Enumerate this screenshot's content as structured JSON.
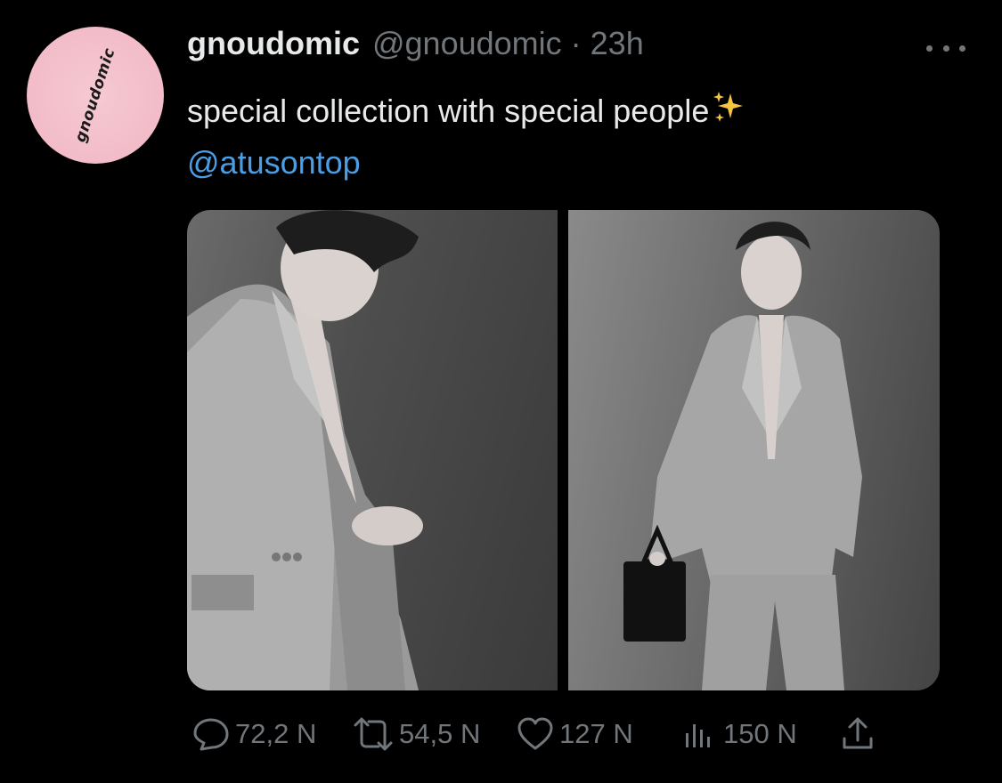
{
  "author": {
    "avatar_text": "gnoudomic",
    "display_name": "gnoudomic",
    "handle": "@gnoudomic",
    "separator": "·",
    "time": "23h"
  },
  "tweet": {
    "text": "special collection with special people",
    "mention": "@atusontop"
  },
  "media": {
    "count": 2,
    "description_alt_1": "",
    "description_alt_2": ""
  },
  "actions": {
    "replies": "72,2 N",
    "retweets": "54,5 N",
    "likes": "127 N",
    "views": "150 N"
  },
  "icons": {
    "more": "more-horizontal-icon",
    "reply": "reply-icon",
    "retweet": "retweet-icon",
    "like": "heart-icon",
    "views": "views-icon",
    "share": "share-icon",
    "sparkle": "sparkles-emoji"
  },
  "colors": {
    "background": "#000000",
    "text": "#e7e9ea",
    "secondary": "#71767b",
    "link": "#4a9ee6",
    "avatar": "#f2bcc8"
  }
}
